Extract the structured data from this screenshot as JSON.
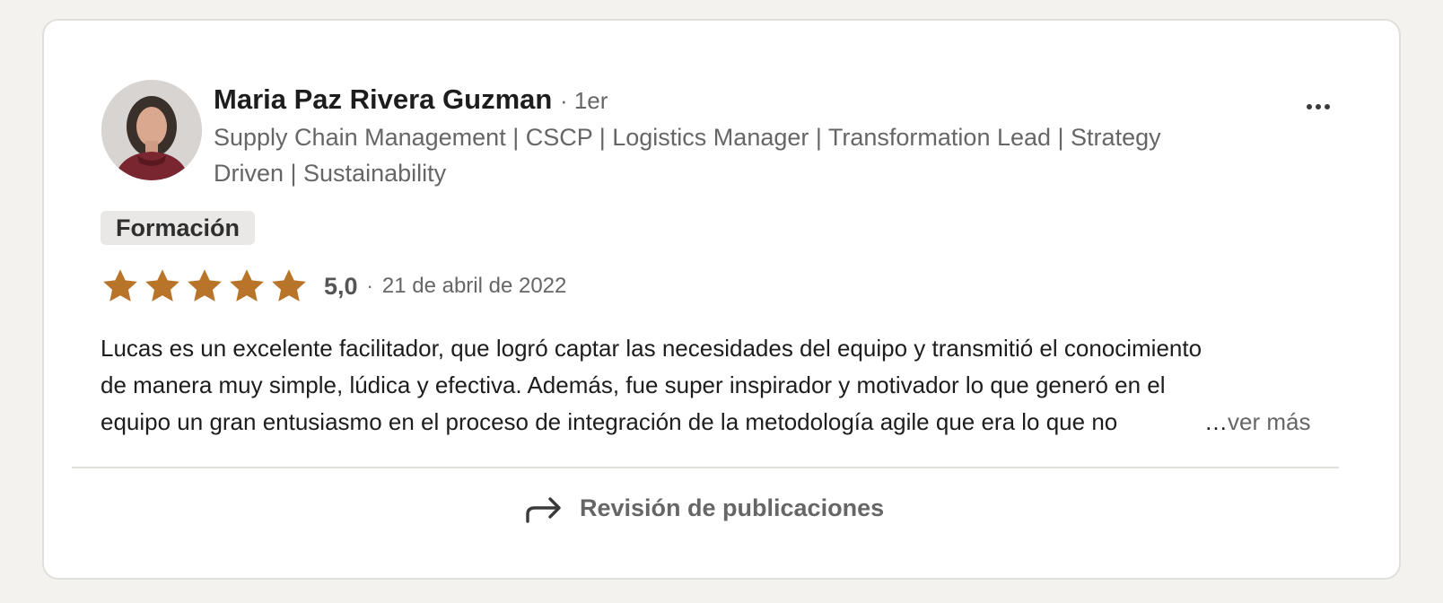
{
  "review": {
    "author": {
      "name": "Maria Paz Rivera Guzman",
      "degree": "· 1er",
      "headline": "Supply Chain Management | CSCP | Logistics Manager | Transformation Lead | Strategy Driven | Sustainability",
      "avatar_icon": "profile-photo"
    },
    "menu_icon": "more-horizontal-icon",
    "tag": "Formación",
    "rating": {
      "stars": 5,
      "max": 5,
      "score_label": "5,0",
      "separator": "·",
      "date": "21 de abril de 2022",
      "star_color": "#b8752a"
    },
    "text_lines": [
      "Lucas es un excelente facilitador, que logró captar las necesidades del equipo y transmitió el conocimiento",
      "de manera muy simple, lúdica y efectiva. Además, fue super inspirador y motivador lo que generó en el",
      "equipo un gran entusiasmo en el proceso de integración de la metodología agile que era lo que no"
    ],
    "ellipsis": "…",
    "see_more_label": "ver más",
    "footer": {
      "label": "Revisión de publicaciones",
      "icon": "share-arrow-icon"
    }
  }
}
